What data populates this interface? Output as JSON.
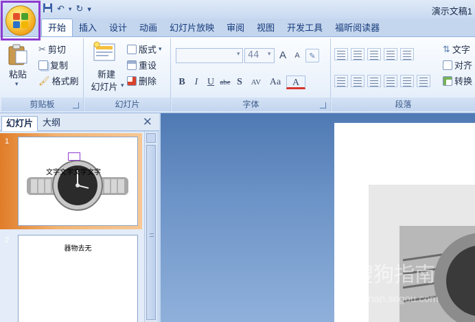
{
  "window": {
    "title": "演示文稿1"
  },
  "ribbon_tabs": [
    "开始",
    "插入",
    "设计",
    "动画",
    "幻灯片放映",
    "审阅",
    "视图",
    "开发工具",
    "福昕阅读器"
  ],
  "clipboard": {
    "paste_label": "粘贴",
    "cut_label": "剪切",
    "copy_label": "复制",
    "format_painter_label": "格式刷",
    "group_label": "剪贴板"
  },
  "slides_group": {
    "new_slide_label_line1": "新建",
    "new_slide_label_line2": "幻灯片",
    "layout_label": "版式",
    "reset_label": "重设",
    "delete_label": "删除",
    "group_label": "幻灯片"
  },
  "font_group": {
    "font_name": "",
    "font_size": "44",
    "bold": "B",
    "italic": "I",
    "underline": "U",
    "strikethrough": "abe",
    "shadow": "S",
    "spacing": "AV",
    "change_case": "Aa",
    "font_color": "A",
    "grow": "A",
    "shrink": "A",
    "group_label": "字体"
  },
  "paragraph_group": {
    "text_direction_label": "文字",
    "align_text_label": "对齐",
    "convert_label": "转换",
    "group_label": "段落"
  },
  "slide_pane": {
    "tab_slides": "幻灯片",
    "tab_outline": "大纲",
    "close": "✕",
    "slides": [
      {
        "number": "1",
        "caption": "文字文字文字文字"
      },
      {
        "number": "2",
        "caption": "器物去无"
      }
    ]
  },
  "watermark": {
    "line1": "搜狗指南",
    "line2": "zhinan.sogou.com"
  },
  "colors": {
    "office_button_highlight": "#8e3bcf",
    "ribbon_background": "#e9f1fb",
    "editor_background": "#6c93c7",
    "selected_thumb": "#e07d2a"
  }
}
